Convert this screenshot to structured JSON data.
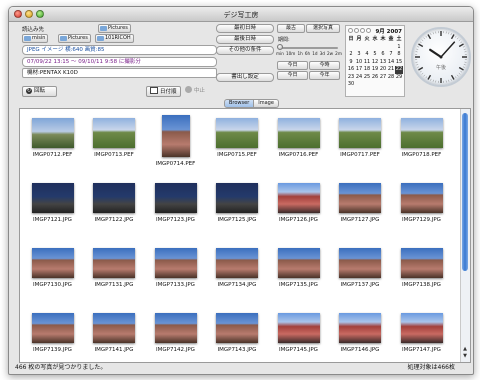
{
  "window": {
    "title": "デジ写工房"
  },
  "left_panel": {
    "folder_label": "読込み先",
    "top_folder": "Pictures",
    "path": [
      "misin",
      "Pictures",
      "101RICOH"
    ],
    "info_jpeg": "JPEG イメージ 横:640 画質:85",
    "info_date": "07/09/22 13:15 〜 09/10/11 9:58 に撮影分",
    "info_model": "機材:PENTAX K10D",
    "rotate_label": "回転",
    "date_order_label": "日付順",
    "stop_label": "中止"
  },
  "center_buttons": {
    "first_date": "最初日時",
    "last_date": "最後日時",
    "other_conditions": "その他の条件",
    "display_settings": "書出し設定"
  },
  "right_controls": {
    "latest": "最古",
    "select_photo": "選択写真",
    "period_label": "期間:",
    "period_ticks": [
      "min",
      "10m",
      "1h",
      "6h",
      "1d",
      "3d",
      "2w",
      "2m"
    ],
    "today": "今日",
    "today_time": "今時",
    "today_b": "今日",
    "this_year": "今年"
  },
  "calendar": {
    "year_month": "9月 2007",
    "weekdays": [
      "日",
      "月",
      "火",
      "水",
      "木",
      "金",
      "土"
    ],
    "rows": [
      [
        "",
        "",
        "",
        "",
        "",
        "",
        "1"
      ],
      [
        "2",
        "3",
        "4",
        "5",
        "6",
        "7",
        "8"
      ],
      [
        "9",
        "10",
        "11",
        "12",
        "13",
        "14",
        "15"
      ],
      [
        "16",
        "17",
        "18",
        "19",
        "20",
        "21",
        "22"
      ],
      [
        "23",
        "24",
        "25",
        "26",
        "27",
        "28",
        "29"
      ],
      [
        "30",
        "",
        "",
        "",
        "",
        "",
        ""
      ]
    ],
    "selected": "22"
  },
  "clock": {
    "label": "午後",
    "hour": 10,
    "minute": 7
  },
  "tabs": [
    "Browser",
    "Image"
  ],
  "photos": [
    {
      "name": "IMGP0712.PEF",
      "tone": "t-sky",
      "port": false
    },
    {
      "name": "IMGP0713.PEF",
      "tone": "t-field",
      "port": false
    },
    {
      "name": "IMGP0714.PEF",
      "tone": "t-crowd",
      "port": true
    },
    {
      "name": "IMGP0715.PEF",
      "tone": "t-field",
      "port": false
    },
    {
      "name": "IMGP0716.PEF",
      "tone": "t-field",
      "port": false
    },
    {
      "name": "IMGP0717.PEF",
      "tone": "t-field",
      "port": false
    },
    {
      "name": "IMGP0718.PEF",
      "tone": "t-field",
      "port": false
    },
    {
      "name": "IMGP7121.JPG",
      "tone": "t-blk",
      "port": false
    },
    {
      "name": "IMGP7122.JPG",
      "tone": "t-blk",
      "port": false
    },
    {
      "name": "IMGP7123.JPG",
      "tone": "t-blk",
      "port": false
    },
    {
      "name": "IMGP7125.JPG",
      "tone": "t-blk",
      "port": false
    },
    {
      "name": "IMGP7126.JPG",
      "tone": "t-red",
      "port": false
    },
    {
      "name": "IMGP7127.JPG",
      "tone": "t-crowd",
      "port": false
    },
    {
      "name": "IMGP7129.JPG",
      "tone": "t-crowd",
      "port": false
    },
    {
      "name": "IMGP7130.JPG",
      "tone": "t-crowd",
      "port": false
    },
    {
      "name": "IMGP7131.JPG",
      "tone": "t-crowd",
      "port": false
    },
    {
      "name": "IMGP7133.JPG",
      "tone": "t-crowd",
      "port": false
    },
    {
      "name": "IMGP7134.JPG",
      "tone": "t-crowd",
      "port": false
    },
    {
      "name": "IMGP7135.JPG",
      "tone": "t-crowd",
      "port": false
    },
    {
      "name": "IMGP7137.JPG",
      "tone": "t-crowd",
      "port": false
    },
    {
      "name": "IMGP7138.JPG",
      "tone": "t-crowd",
      "port": false
    },
    {
      "name": "IMGP7139.JPG",
      "tone": "t-crowd",
      "port": false
    },
    {
      "name": "IMGP7141.JPG",
      "tone": "t-crowd",
      "port": false
    },
    {
      "name": "IMGP7142.JPG",
      "tone": "t-crowd",
      "port": false
    },
    {
      "name": "IMGP7143.JPG",
      "tone": "t-crowd",
      "port": false
    },
    {
      "name": "IMGP7145.JPG",
      "tone": "t-red",
      "port": false
    },
    {
      "name": "IMGP7146.JPG",
      "tone": "t-red",
      "port": false
    },
    {
      "name": "IMGP7147.JPG",
      "tone": "t-red",
      "port": false
    }
  ],
  "status": {
    "found": "466 枚の写真が見つかりました。",
    "processed": "処理対象は466枚"
  }
}
